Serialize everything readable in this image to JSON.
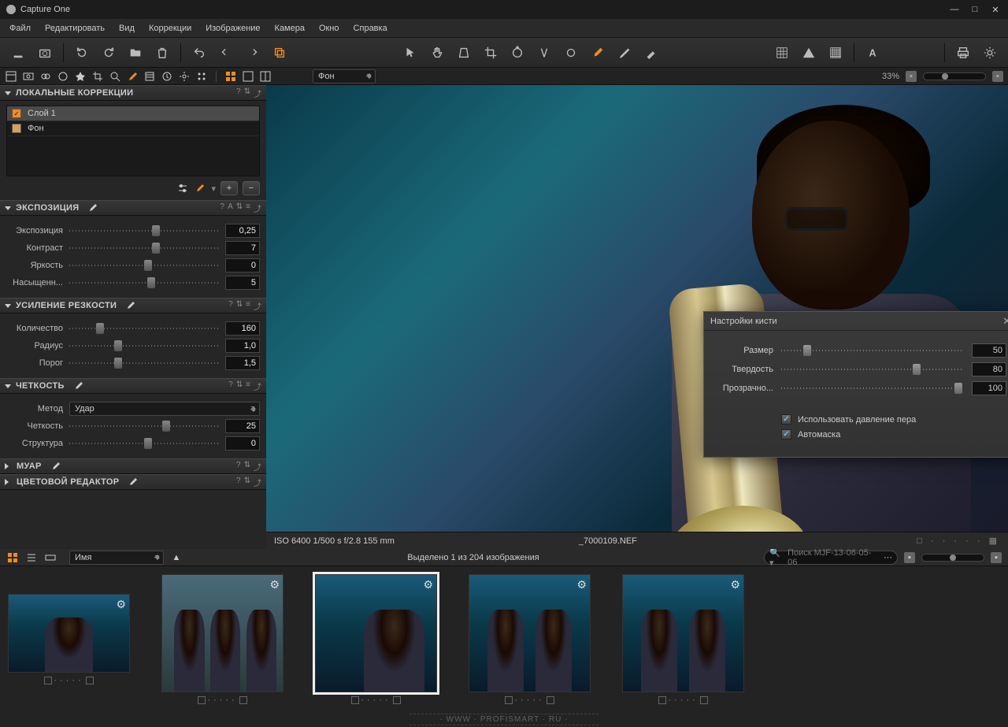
{
  "app_title": "Capture One",
  "menubar": [
    "Файл",
    "Редактировать",
    "Вид",
    "Коррекции",
    "Изображение",
    "Камера",
    "Окно",
    "Справка"
  ],
  "zoom_pct": "33%",
  "layer_dropdown": "Фон",
  "panels": {
    "local": {
      "title": "ЛОКАЛЬНЫЕ КОРРЕКЦИИ",
      "layers": [
        {
          "name": "Слой 1",
          "selected": true
        },
        {
          "name": "Фон",
          "selected": false
        }
      ]
    },
    "exposure": {
      "title": "ЭКСПОЗИЦИЯ",
      "rows": [
        {
          "label": "Экспозиция",
          "value": "0,25",
          "pos": 55
        },
        {
          "label": "Контраст",
          "value": "7",
          "pos": 55
        },
        {
          "label": "Яркость",
          "value": "0",
          "pos": 50
        },
        {
          "label": "Насыщенн...",
          "value": "5",
          "pos": 52
        }
      ]
    },
    "sharp": {
      "title": "УСИЛЕНИЕ РЕЗКОСТИ",
      "rows": [
        {
          "label": "Количество",
          "value": "160",
          "pos": 18
        },
        {
          "label": "Радиус",
          "value": "1,0",
          "pos": 30
        },
        {
          "label": "Порог",
          "value": "1,5",
          "pos": 30
        }
      ]
    },
    "clarity": {
      "title": "ЧЕТКОСТЬ",
      "method_label": "Метод",
      "method_value": "Удар",
      "rows": [
        {
          "label": "Четкость",
          "value": "25",
          "pos": 62
        },
        {
          "label": "Структура",
          "value": "0",
          "pos": 50
        }
      ]
    },
    "moire": {
      "title": "МУАР"
    },
    "coloreditor": {
      "title": "ЦВЕТОВОЙ РЕДАКТОР"
    }
  },
  "dialog": {
    "title": "Настройки кисти",
    "rows": [
      {
        "label": "Размер",
        "value": "50",
        "pos": 12
      },
      {
        "label": "Твердость",
        "value": "80",
        "pos": 72
      },
      {
        "label": "Прозрачно...",
        "value": "100",
        "pos": 95
      }
    ],
    "chk_pressure": "Использовать давление пера",
    "chk_automask": "Автомаска"
  },
  "info": {
    "meta": "ISO 6400 1/500 s f/2.8 155 mm",
    "filename": "_7000109.NEF"
  },
  "filmstrip": {
    "sort_by": "Имя",
    "status": "Выделено 1 из 204 изображения",
    "search_placeholder": "Поиск MJF-13-06-05-06"
  },
  "watermark": "· WWW · PROFISMART · RU ·"
}
